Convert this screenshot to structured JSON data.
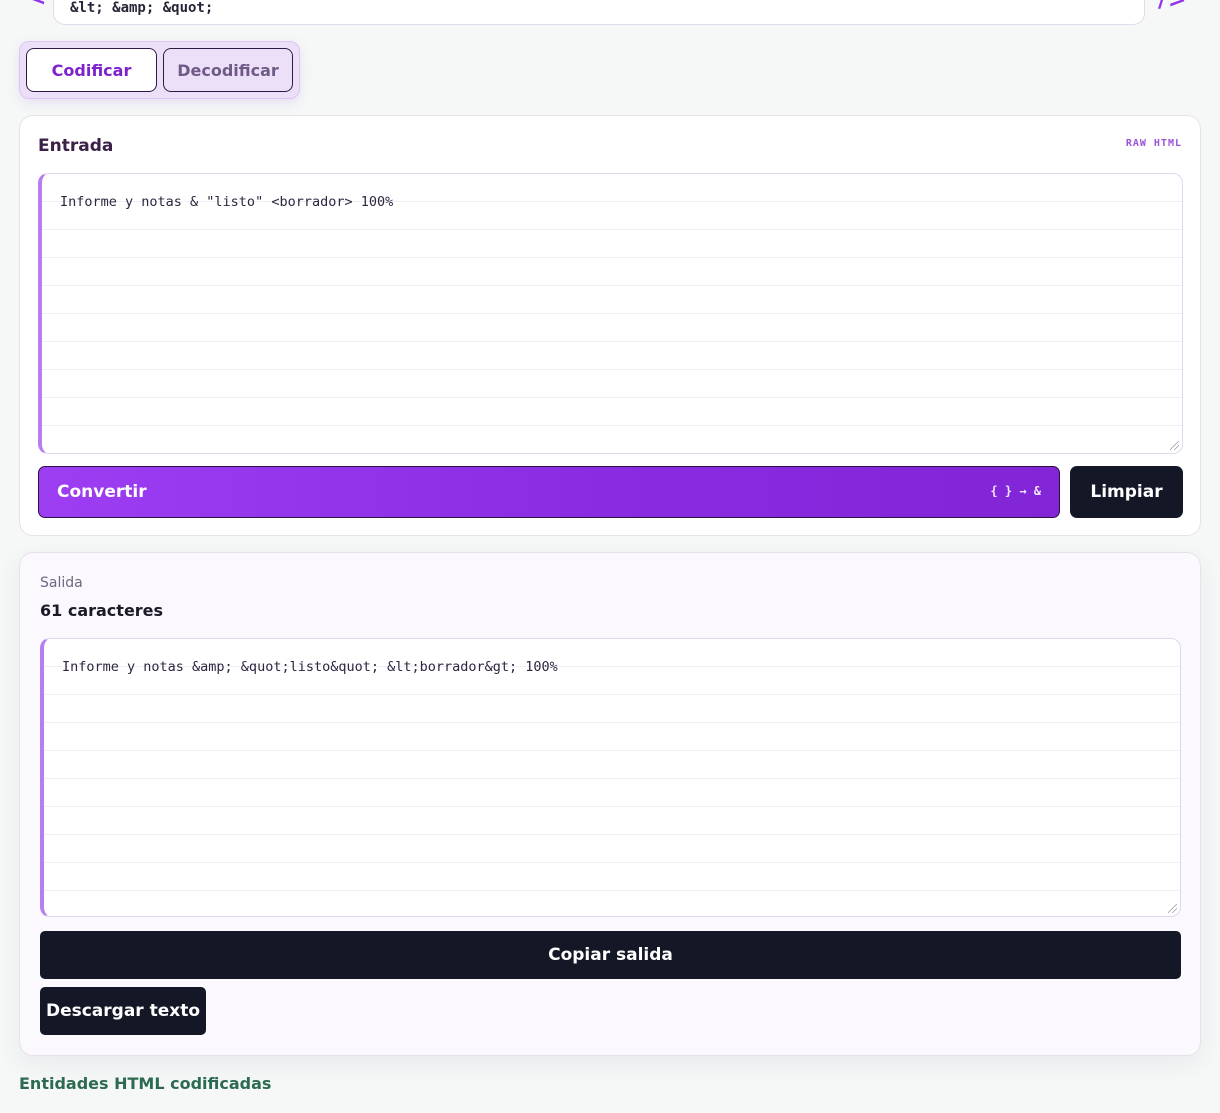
{
  "header": {
    "left_icon": "chevron-left-icon",
    "left_glyph": "<",
    "example_entities": "&lt; &amp; &quot;",
    "right_icon": "code-close-icon",
    "right_glyph": "/>"
  },
  "mode": {
    "encode_label": "Codificar",
    "decode_label": "Decodificar",
    "selected": "Codificar"
  },
  "input_card": {
    "title": "Entrada",
    "tag": "RAW HTML",
    "value": "Informe y notas & \"listo\" <borrador> 100%",
    "convert_label": "Convertir",
    "convert_hint": "{ } → &",
    "clear_label": "Limpiar"
  },
  "output_card": {
    "label": "Salida",
    "count": "61 caracteres",
    "value": "Informe y notas &amp; &quot;listo&quot; &lt;borrador&gt; 100%",
    "copy_label": "Copiar salida",
    "download_label": "Descargar texto"
  },
  "footer": {
    "link_label": "Entidades HTML codificadas"
  },
  "colors": {
    "accent": "#8a2be2",
    "dark_button": "#131726",
    "footer_link": "#2d6a52"
  }
}
